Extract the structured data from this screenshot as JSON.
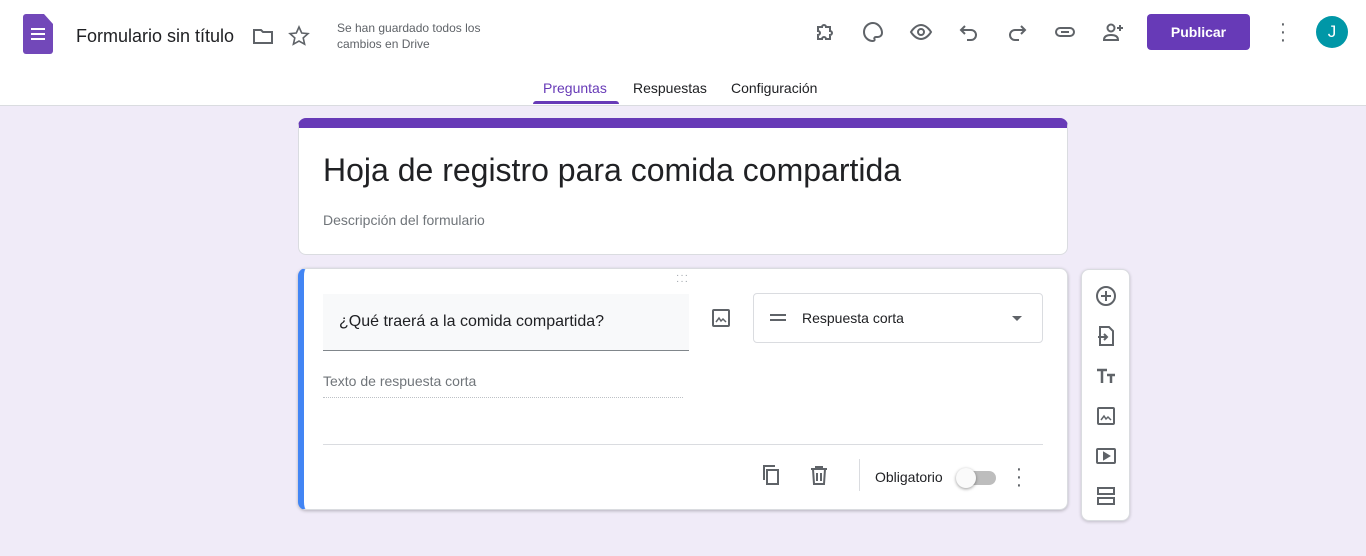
{
  "header": {
    "doc_title": "Formulario sin título",
    "save_status": "Se han guardado todos los cambios en Drive",
    "publish_label": "Publicar",
    "avatar_letter": "J",
    "accent": "#673ab7",
    "avatar_color": "#0097a7"
  },
  "tabs": [
    {
      "label": "Preguntas",
      "active": true
    },
    {
      "label": "Respuestas"
    },
    {
      "label": "Configuración"
    }
  ],
  "form": {
    "title": "Hoja de registro para comida compartida",
    "description_placeholder": "Descripción del formulario"
  },
  "question": {
    "text": "¿Qué traerá a la comida compartida?",
    "type": "Respuesta corta",
    "answer_placeholder": "Texto de respuesta corta",
    "required_label": "Obligatorio",
    "required": false
  }
}
